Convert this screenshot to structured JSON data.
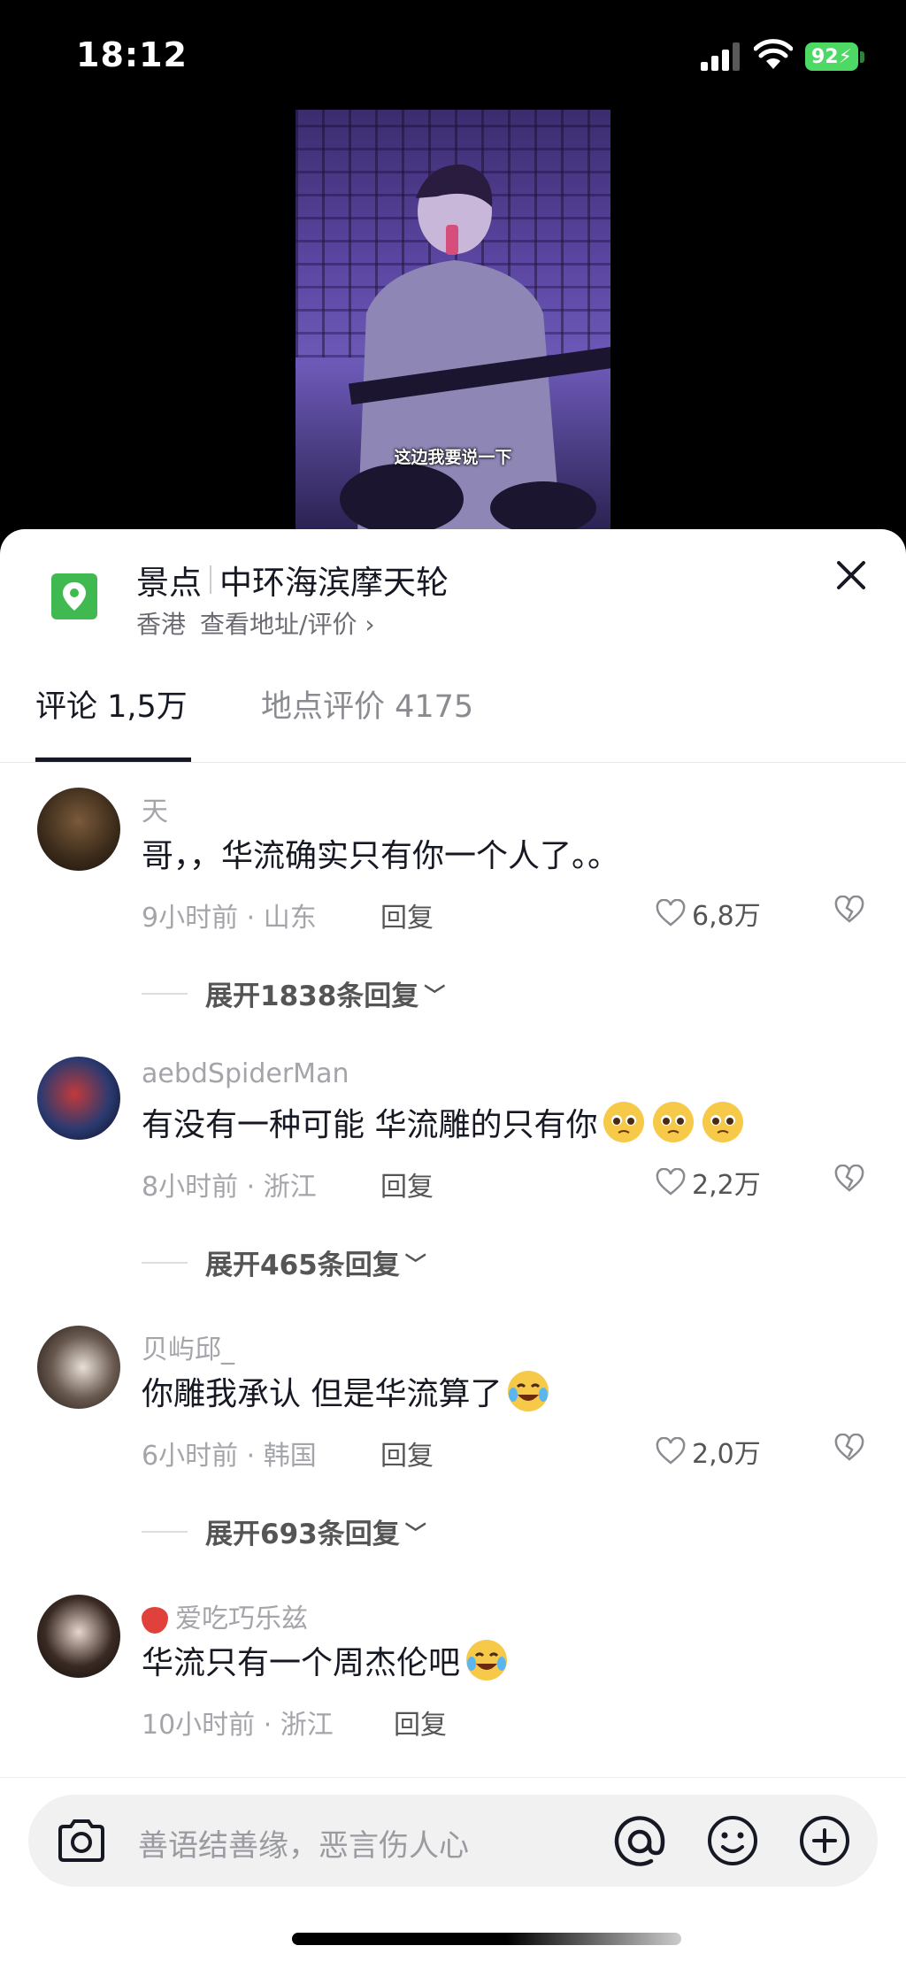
{
  "status_bar": {
    "time": "18:12",
    "battery": "92"
  },
  "video": {
    "subtitle": "这边我要说一下"
  },
  "location": {
    "category": "景点",
    "name": "中环海滨摩天轮",
    "city": "香港",
    "detail_link": "查看地址/评价"
  },
  "tabs": [
    {
      "label": "评论 1,5万"
    },
    {
      "label": "地点评价 4175"
    }
  ],
  "comments": [
    {
      "user": "天",
      "text": "哥，，华流确实只有你一个人了。。",
      "time": "9小时前",
      "region": "山东",
      "reply": "回复",
      "likes": "6,8万",
      "expand": "展开1838条回复",
      "emoji_count": 0
    },
    {
      "user": "aebdSpiderMan",
      "text": "有没有一种可能 华流雕的只有你",
      "time": "8小时前",
      "region": "浙江",
      "reply": "回复",
      "likes": "2,2万",
      "expand": "展开465条回复",
      "emoji_count": 3
    },
    {
      "user": "贝屿邱_",
      "text": "你雕我承认 但是华流算了",
      "time": "6小时前",
      "region": "韩国",
      "reply": "回复",
      "likes": "2,0万",
      "expand": "展开693条回复",
      "emoji_count": 1
    },
    {
      "user": "爱吃巧乐兹",
      "text": "华流只有一个周杰伦吧",
      "time": "10小时前",
      "region": "浙江",
      "reply": "回复",
      "likes": "",
      "expand": "",
      "emoji_count": 1
    }
  ],
  "input": {
    "placeholder": "善语结善缘，恶言伤人心"
  },
  "colors": {
    "accent": "#3fb950",
    "text": "#161823",
    "muted": "#a4a5aa"
  }
}
